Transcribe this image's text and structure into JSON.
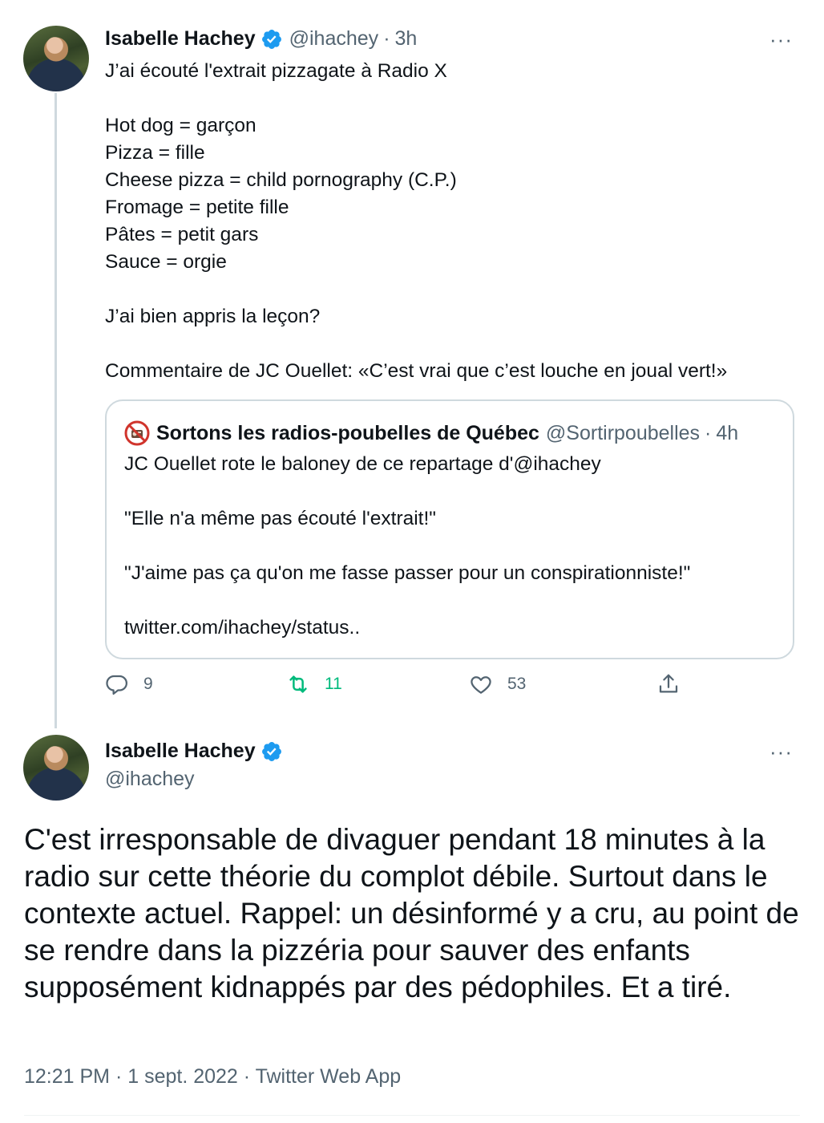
{
  "first_tweet": {
    "author_name": "Isabelle Hachey",
    "handle": "@ihachey",
    "separator": "·",
    "time": "3h",
    "more": "···",
    "text": "J’ai écouté l'extrait pizzagate à Radio X\n\nHot dog = garçon\nPizza = fille\nCheese pizza = child pornography (C.P.)\nFromage = petite fille\nPâtes = petit gars\nSauce = orgie\n\nJ’ai bien appris la leçon?\n\nCommentaire de JC Ouellet: «C’est vrai que c’est louche en joual vert!»",
    "quoted": {
      "author_name": "Sortons les radios-poubelles de Québec",
      "handle": "@Sortirpoubelles",
      "separator": "·",
      "time": "4h",
      "text": "JC Ouellet rote le baloney de ce repartage d'@ihachey\n\n\"Elle n'a même pas écouté l'extrait!\"\n\n\"J'aime pas ça qu'on me fasse passer pour un conspirationniste!\"\n\ntwitter.com/ihachey/status.."
    },
    "actions": {
      "replies": "9",
      "retweets": "11",
      "likes": "53"
    }
  },
  "main_tweet": {
    "author_name": "Isabelle Hachey",
    "handle": "@ihachey",
    "more": "···",
    "text": "C'est irresponsable de divaguer pendant 18 minutes à la radio sur cette théorie du complot débile. Surtout dans le contexte actuel. Rappel: un désinformé y a cru, au point de se rendre dans la pizzéria pour sauver des enfants supposément kidnappés par des pédophiles. Et a tiré.",
    "meta": "12:21 PM · 1 sept. 2022 · Twitter Web App"
  },
  "icons": {
    "verified": "verified-badge-icon",
    "reply": "reply-icon",
    "retweet": "retweet-icon",
    "like": "heart-icon",
    "share": "share-icon",
    "quote_avatar": "no-radio-icon"
  },
  "colors": {
    "verified": "#1d9bf0",
    "retweet": "#00ba7c",
    "secondary_text": "#536471"
  }
}
